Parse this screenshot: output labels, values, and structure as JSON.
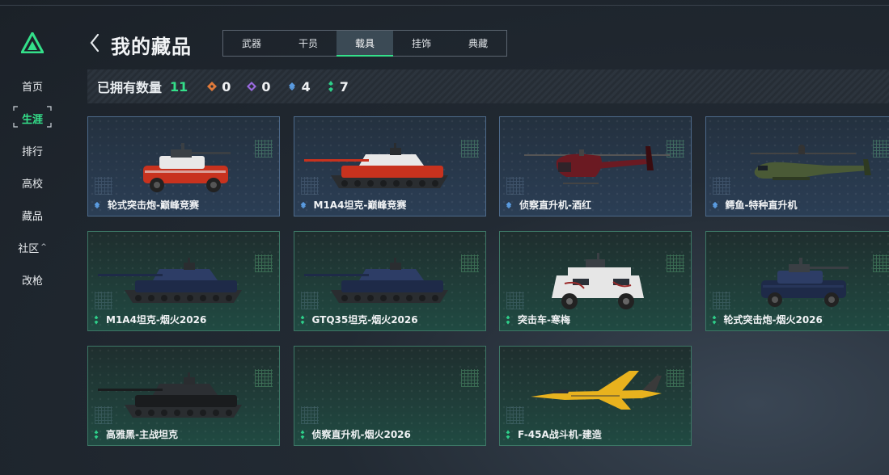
{
  "sidebar": {
    "items": [
      {
        "label": "首页"
      },
      {
        "label": "生涯",
        "active": true
      },
      {
        "label": "排行"
      },
      {
        "label": "高校"
      },
      {
        "label": "藏品"
      },
      {
        "label": "社区",
        "caret": "^"
      },
      {
        "label": "改枪"
      }
    ]
  },
  "header": {
    "title": "我的藏品",
    "tabs": [
      {
        "label": "武器"
      },
      {
        "label": "干员"
      },
      {
        "label": "载具",
        "active": true
      },
      {
        "label": "挂饰"
      },
      {
        "label": "典藏"
      }
    ]
  },
  "summary": {
    "label": "已拥有数量",
    "total": "11",
    "rarities": [
      {
        "icon": "orange-gem-icon",
        "color": "#e07a3a",
        "count": "0"
      },
      {
        "icon": "purple-gem-icon",
        "color": "#9a6ae0",
        "count": "0"
      },
      {
        "icon": "blue-gem-icon",
        "color": "#5a9be0",
        "count": "4"
      },
      {
        "icon": "green-gem-icon",
        "color": "#2ed08a",
        "count": "7"
      }
    ]
  },
  "items": [
    {
      "name": "轮式突击炮-巅峰竞赛",
      "rarity": "blue",
      "vehicle": "wheeled-assault-gun",
      "colors": [
        "#c8321e",
        "#e8e8e8"
      ]
    },
    {
      "name": "M1A4坦克-巅峰竞赛",
      "rarity": "blue",
      "vehicle": "tank",
      "colors": [
        "#c8321e",
        "#e8e8e8"
      ]
    },
    {
      "name": "侦察直升机-酒红",
      "rarity": "blue",
      "vehicle": "scout-helicopter",
      "colors": [
        "#6b1a22",
        "#3a0c10"
      ]
    },
    {
      "name": "鳄鱼-特种直升机",
      "rarity": "blue",
      "vehicle": "attack-helicopter",
      "colors": [
        "#4a5a36",
        "#2e3a22"
      ]
    },
    {
      "name": "M1A4坦克-烟火2026",
      "rarity": "green",
      "vehicle": "tank",
      "colors": [
        "#1e2a48",
        "#2d3d66"
      ]
    },
    {
      "name": "GTQ35坦克-烟火2026",
      "rarity": "green",
      "vehicle": "tank",
      "colors": [
        "#1e2a48",
        "#2d3d66"
      ]
    },
    {
      "name": "突击车-寒梅",
      "rarity": "green",
      "vehicle": "assault-vehicle",
      "colors": [
        "#e6e6e6",
        "#9a2a2a"
      ]
    },
    {
      "name": "轮式突击炮-烟火2026",
      "rarity": "green",
      "vehicle": "wheeled-assault-gun",
      "colors": [
        "#1e2a48",
        "#2d3d66"
      ]
    },
    {
      "name": "高雅黑-主战坦克",
      "rarity": "green",
      "vehicle": "tank",
      "colors": [
        "#1a1c1e",
        "#2c2f33"
      ]
    },
    {
      "name": "侦察直升机-烟火2026",
      "rarity": "green",
      "vehicle": "none",
      "colors": [
        "#1e2a48",
        "#2d3d66"
      ]
    },
    {
      "name": "F-45A战斗机-建造",
      "rarity": "green",
      "vehicle": "fighter-jet",
      "colors": [
        "#e8b21e",
        "#3a3a3a"
      ]
    }
  ]
}
